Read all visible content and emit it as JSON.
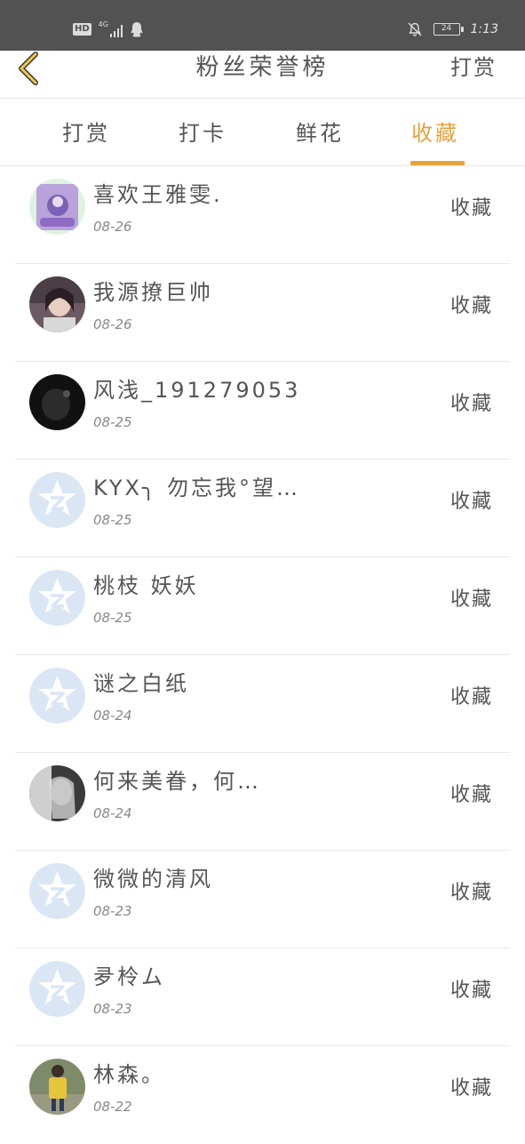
{
  "status_bar": {
    "hd_badge": "HD",
    "network": "4G",
    "battery": "24",
    "time": "1:13"
  },
  "header": {
    "title": "粉丝荣誉榜",
    "right_link": "打赏",
    "back_icon": "chevron-left-icon"
  },
  "colors": {
    "accent": "#e6a23c",
    "status_bar_bg": "#525252",
    "text": "#555555",
    "default_avatar": "#dbe6f5"
  },
  "tabs": [
    {
      "label": "打赏",
      "active": false
    },
    {
      "label": "打卡",
      "active": false
    },
    {
      "label": "鲜花",
      "active": false
    },
    {
      "label": "收藏",
      "active": true
    }
  ],
  "list": [
    {
      "name": "喜欢王雅雯.",
      "date": "08-26",
      "action": "收藏",
      "avatar": "photo-purple"
    },
    {
      "name": "我源撩巨帅",
      "date": "08-26",
      "action": "收藏",
      "avatar": "photo-girl"
    },
    {
      "name": "风浅_191279053",
      "date": "08-25",
      "action": "收藏",
      "avatar": "photo-dark"
    },
    {
      "name": "KYX╮ 勿忘我°望…",
      "date": "08-25",
      "action": "收藏",
      "avatar": "default-qq-icon"
    },
    {
      "name": "桃枝 妖妖",
      "date": "08-25",
      "action": "收藏",
      "avatar": "default-qq-icon"
    },
    {
      "name": "谜之白纸",
      "date": "08-24",
      "action": "收藏",
      "avatar": "default-qq-icon"
    },
    {
      "name": "何来美眷，何…",
      "date": "08-24",
      "action": "收藏",
      "avatar": "photo-bw"
    },
    {
      "name": "微微的清风",
      "date": "08-23",
      "action": "收藏",
      "avatar": "default-qq-icon"
    },
    {
      "name": "夛柃ム",
      "date": "08-23",
      "action": "收藏",
      "avatar": "default-qq-icon"
    },
    {
      "name": "林森。",
      "date": "08-22",
      "action": "收藏",
      "avatar": "photo-yellow"
    }
  ]
}
